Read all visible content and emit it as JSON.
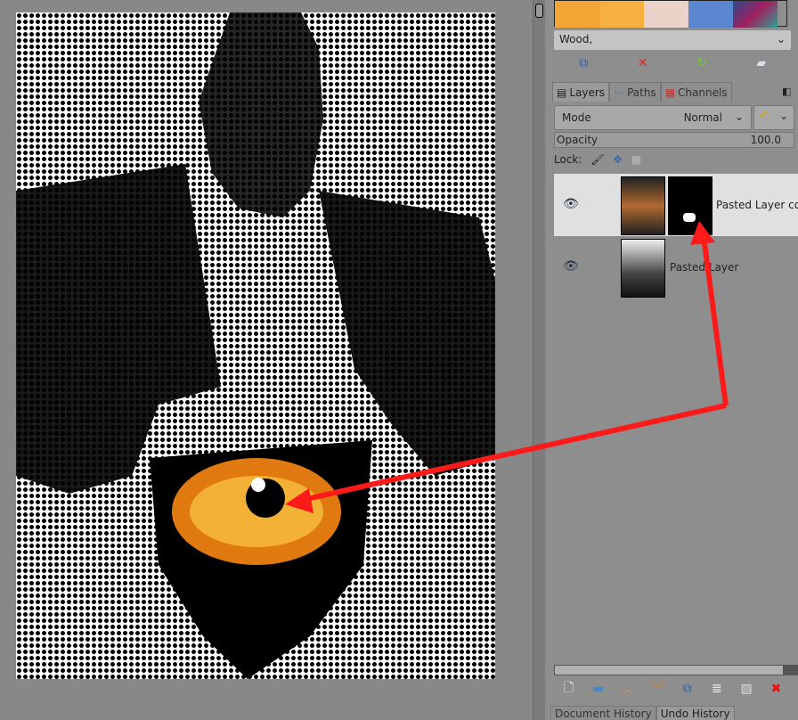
{
  "patterns": {
    "selected": "Wood,",
    "swatches": [
      "#f2a535",
      "#f5b040",
      "#ead2c8",
      "#5b86d0",
      "#2a4a8a"
    ]
  },
  "pattern_actions": [
    "duplicate-icon",
    "delete-icon",
    "refresh-icon",
    "open-folder-icon"
  ],
  "tabs": [
    {
      "label": "Layers",
      "icon": "layers-icon"
    },
    {
      "label": "Paths",
      "icon": "paths-icon"
    },
    {
      "label": "Channels",
      "icon": "channels-icon"
    }
  ],
  "mode": {
    "label": "Mode",
    "value": "Normal"
  },
  "opacity": {
    "label": "Opacity",
    "value": "100.0"
  },
  "lock": {
    "label": "Lock:"
  },
  "layers": [
    {
      "name": "Pasted Layer co",
      "visible": true,
      "selected": true,
      "has_mask": true
    },
    {
      "name": "Pasted Layer",
      "visible": true,
      "selected": false,
      "has_mask": false
    }
  ],
  "layer_actions": [
    "new-layer-icon",
    "new-group-icon",
    "raise-icon",
    "lower-icon",
    "duplicate-icon",
    "anchor-icon",
    "mask-icon",
    "delete-icon"
  ],
  "bottom_tabs": [
    {
      "label": "Document History"
    },
    {
      "label": "Undo History"
    }
  ],
  "annotation": {
    "arrow_color": "#ff1a1a"
  }
}
